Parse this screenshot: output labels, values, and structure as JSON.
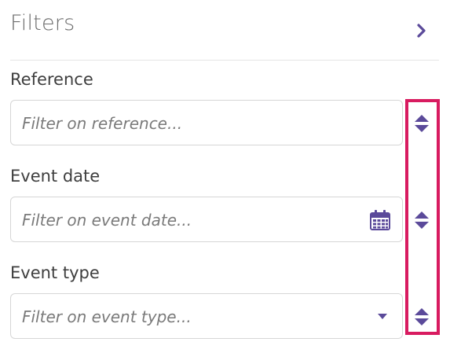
{
  "panel": {
    "title": "Filters",
    "collapse_icon": "chevron-right-icon"
  },
  "filters": [
    {
      "label": "Reference",
      "placeholder": "Filter on reference...",
      "value": "",
      "icon": ""
    },
    {
      "label": "Event date",
      "placeholder": "Filter on event date...",
      "value": "",
      "icon": "calendar-icon"
    },
    {
      "label": "Event type",
      "placeholder": "Filter on event type...",
      "value": "",
      "icon": "caret-down-icon"
    }
  ],
  "handles": {
    "icon": "sort-up-down-icon"
  },
  "colors": {
    "accent": "#5b4a9a",
    "highlight": "#d81b60",
    "border": "#d6d6d6",
    "label": "#3e3e3e",
    "title": "#6d6d6d"
  }
}
